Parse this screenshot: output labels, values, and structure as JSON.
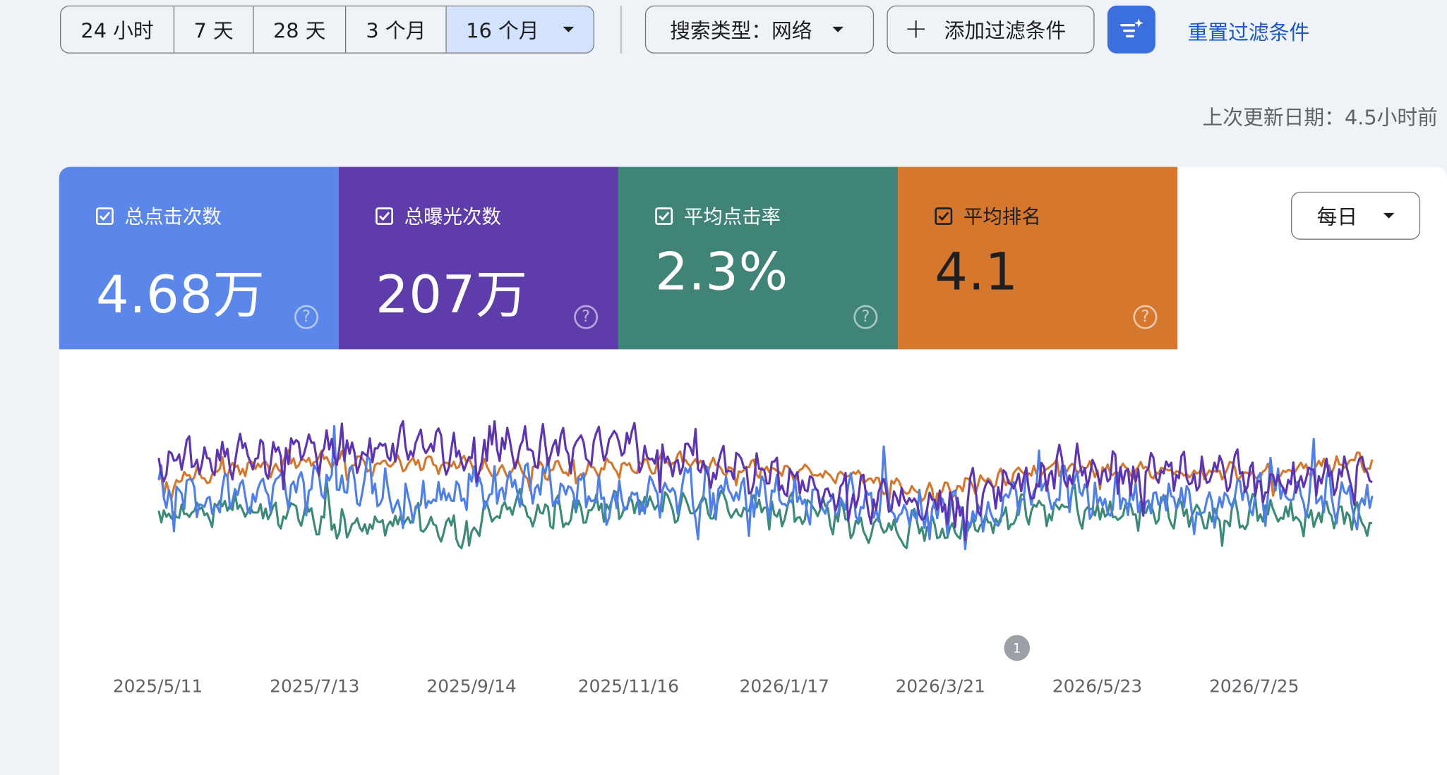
{
  "toolbar": {
    "ranges": [
      {
        "label": "24 小时",
        "active": false
      },
      {
        "label": "7 天",
        "active": false
      },
      {
        "label": "28 天",
        "active": false
      },
      {
        "label": "3 个月",
        "active": false
      },
      {
        "label": "16 个月",
        "active": true
      }
    ],
    "search_type": "搜索类型：网络",
    "add_filter": "添加过滤条件",
    "reset_filters": "重置过滤条件"
  },
  "last_updated": "上次更新日期：4.5小时前",
  "metrics": [
    {
      "label": "总点击次数",
      "value": "4.68万",
      "color": "#5b86ea",
      "checked": true
    },
    {
      "label": "总曝光次数",
      "value": "207万",
      "color": "#5e3dab",
      "checked": true
    },
    {
      "label": "平均点击率",
      "value": "2.3%",
      "color": "#408477",
      "checked": true
    },
    {
      "label": "平均排名",
      "value": "4.1",
      "color": "#d6772e",
      "checked": true
    }
  ],
  "granularity": "每日",
  "annotation": {
    "label": "1",
    "date": "2026/4/10"
  },
  "chart_data": {
    "type": "line",
    "x_ticks": [
      "2025/5/11",
      "2025/7/13",
      "2025/9/14",
      "2025/11/16",
      "2026/1/17",
      "2026/3/21",
      "2026/5/23",
      "2026/7/25"
    ],
    "x_range": [
      "2025/5/11",
      "2026/8/31"
    ],
    "days_shown": 478,
    "series": [
      {
        "metric": "总点击次数",
        "color": "#4f7fe8",
        "points": [
          [
            0,
            0.45
          ],
          [
            30,
            0.42
          ],
          [
            60,
            0.4
          ],
          [
            80,
            0.3
          ],
          [
            100,
            0.55
          ],
          [
            120,
            0.35
          ],
          [
            135,
            0.42
          ],
          [
            160,
            0.36
          ],
          [
            180,
            0.5
          ],
          [
            200,
            0.4
          ],
          [
            230,
            0.44
          ],
          [
            260,
            0.48
          ],
          [
            280,
            0.45
          ],
          [
            300,
            0.55
          ],
          [
            320,
            0.6
          ],
          [
            340,
            0.42
          ],
          [
            360,
            0.4
          ],
          [
            380,
            0.45
          ],
          [
            400,
            0.48
          ],
          [
            420,
            0.5
          ],
          [
            440,
            0.42
          ],
          [
            460,
            0.46
          ],
          [
            477,
            0.45
          ]
        ]
      },
      {
        "metric": "总曝光次数",
        "color": "#5e35b1",
        "points": [
          [
            0,
            0.25
          ],
          [
            30,
            0.2
          ],
          [
            60,
            0.18
          ],
          [
            90,
            0.15
          ],
          [
            120,
            0.2
          ],
          [
            135,
            0.15
          ],
          [
            160,
            0.18
          ],
          [
            180,
            0.12
          ],
          [
            200,
            0.22
          ],
          [
            230,
            0.3
          ],
          [
            260,
            0.38
          ],
          [
            280,
            0.45
          ],
          [
            300,
            0.5
          ],
          [
            320,
            0.42
          ],
          [
            340,
            0.35
          ],
          [
            360,
            0.28
          ],
          [
            380,
            0.3
          ],
          [
            400,
            0.32
          ],
          [
            420,
            0.3
          ],
          [
            440,
            0.36
          ],
          [
            460,
            0.32
          ],
          [
            477,
            0.3
          ]
        ]
      },
      {
        "metric": "平均点击率",
        "color": "#3d8a78",
        "points": [
          [
            0,
            0.55
          ],
          [
            30,
            0.52
          ],
          [
            60,
            0.55
          ],
          [
            80,
            0.62
          ],
          [
            100,
            0.58
          ],
          [
            120,
            0.65
          ],
          [
            135,
            0.5
          ],
          [
            160,
            0.55
          ],
          [
            180,
            0.48
          ],
          [
            200,
            0.52
          ],
          [
            230,
            0.5
          ],
          [
            260,
            0.55
          ],
          [
            280,
            0.62
          ],
          [
            300,
            0.65
          ],
          [
            320,
            0.62
          ],
          [
            340,
            0.55
          ],
          [
            360,
            0.5
          ],
          [
            380,
            0.55
          ],
          [
            400,
            0.52
          ],
          [
            420,
            0.55
          ],
          [
            440,
            0.55
          ],
          [
            460,
            0.58
          ],
          [
            477,
            0.55
          ]
        ]
      },
      {
        "metric": "平均排名",
        "color": "#d4782e",
        "points": [
          [
            0,
            0.38
          ],
          [
            20,
            0.3
          ],
          [
            60,
            0.22
          ],
          [
            100,
            0.25
          ],
          [
            135,
            0.28
          ],
          [
            160,
            0.28
          ],
          [
            180,
            0.26
          ],
          [
            200,
            0.24
          ],
          [
            230,
            0.28
          ],
          [
            260,
            0.32
          ],
          [
            280,
            0.35
          ],
          [
            300,
            0.42
          ],
          [
            320,
            0.38
          ],
          [
            340,
            0.32
          ],
          [
            360,
            0.28
          ],
          [
            380,
            0.3
          ],
          [
            400,
            0.3
          ],
          [
            420,
            0.3
          ],
          [
            440,
            0.32
          ],
          [
            460,
            0.26
          ],
          [
            477,
            0.24
          ]
        ]
      }
    ]
  }
}
